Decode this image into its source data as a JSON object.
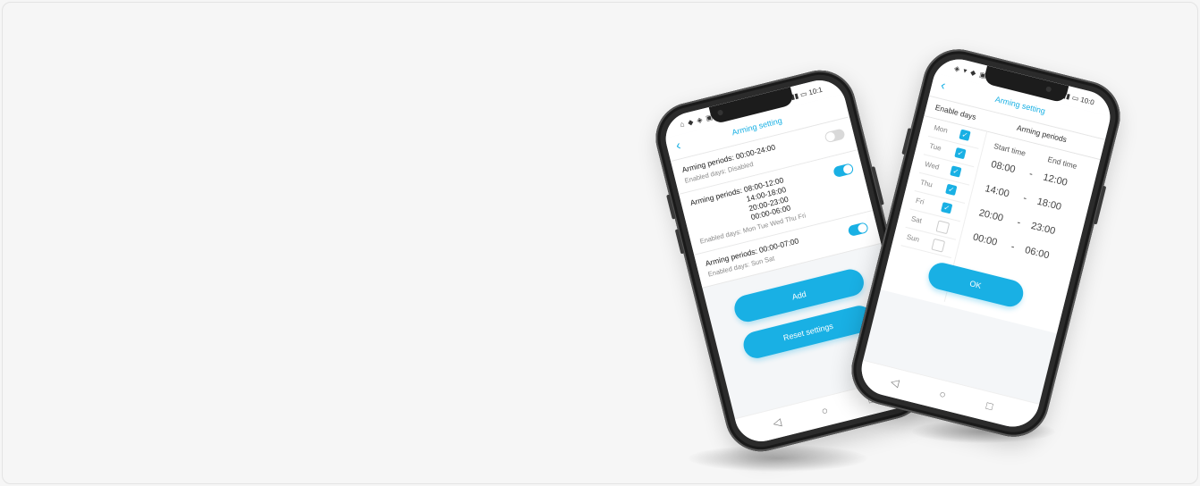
{
  "colors": {
    "accent": "#19b0e4",
    "background": "#f6f6f6",
    "phone_frame": "#2b2b2b"
  },
  "phone_left": {
    "status": {
      "left_icons": "⌂ ◆ ◈ ▣",
      "right_icons": "▮▮ ▭ 10:1"
    },
    "header": {
      "back_icon": "‹",
      "title": "Arming setting"
    },
    "periods": [
      {
        "title": "Arming periods: 00:00-24:00",
        "extra_times": [],
        "days": "Enabled days: Disabled",
        "enabled": false
      },
      {
        "title": "Arming periods: 08:00-12:00",
        "extra_times": [
          "14:00-18:00",
          "20:00-23:00",
          "00:00-06:00"
        ],
        "days": "Enabled days: Mon Tue Wed Thu Fri",
        "enabled": true
      },
      {
        "title": "Arming periods: 00:00-07:00",
        "extra_times": [],
        "days": "Enabled days: Sun Sat",
        "enabled": true
      }
    ],
    "buttons": {
      "add": "Add",
      "reset": "Reset settings"
    },
    "sysnav": {
      "back": "◁",
      "home": "○",
      "recent": "□"
    }
  },
  "phone_right": {
    "status": {
      "left_icons": "◈ ▾ ◆ ▣",
      "right_icons": "▮▮ ▭ 10:0"
    },
    "header": {
      "back_icon": "‹",
      "title": "Arming setting"
    },
    "tabs": {
      "days": "Enable days",
      "periods": "Arming periods"
    },
    "columns": {
      "start": "Start time",
      "end": "End time"
    },
    "days": [
      {
        "label": "Mon",
        "checked": true
      },
      {
        "label": "Tue",
        "checked": true
      },
      {
        "label": "Wed",
        "checked": true
      },
      {
        "label": "Thu",
        "checked": true
      },
      {
        "label": "Fri",
        "checked": true
      },
      {
        "label": "Sat",
        "checked": false
      },
      {
        "label": "Sun",
        "checked": false
      }
    ],
    "times": [
      {
        "start": "08:00",
        "end": "12:00"
      },
      {
        "start": "14:00",
        "end": "18:00"
      },
      {
        "start": "20:00",
        "end": "23:00"
      },
      {
        "start": "00:00",
        "end": "06:00"
      }
    ],
    "dash": "-",
    "ok": "OK",
    "sysnav": {
      "back": "◁",
      "home": "○",
      "recent": "□"
    }
  }
}
